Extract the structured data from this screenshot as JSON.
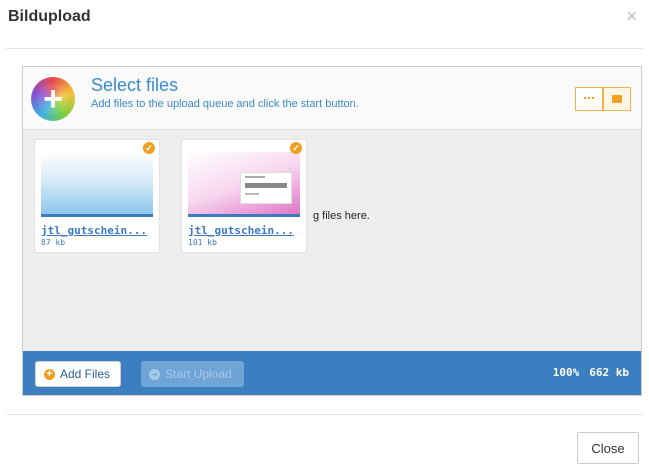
{
  "dialog": {
    "title": "Bildupload",
    "close_icon": "×",
    "close_button": "Close"
  },
  "uploader": {
    "title": "Select files",
    "subtitle": "Add files to the upload queue and click the start button.",
    "drop_text": "g files here.",
    "view_modes": [
      "list",
      "thumbnails"
    ],
    "active_view": "thumbnails",
    "files": [
      {
        "name": "jtl_gutschein...",
        "size": "87 kb"
      },
      {
        "name": "jtl_gutschein...",
        "size": "101 kb"
      }
    ],
    "footer": {
      "add_files": "Add Files",
      "start_upload": "Start Upload",
      "percent": "100%",
      "total_size": "662 kb"
    }
  },
  "colors": {
    "accent_blue": "#3b7fc0",
    "accent_orange": "#f0a020"
  }
}
